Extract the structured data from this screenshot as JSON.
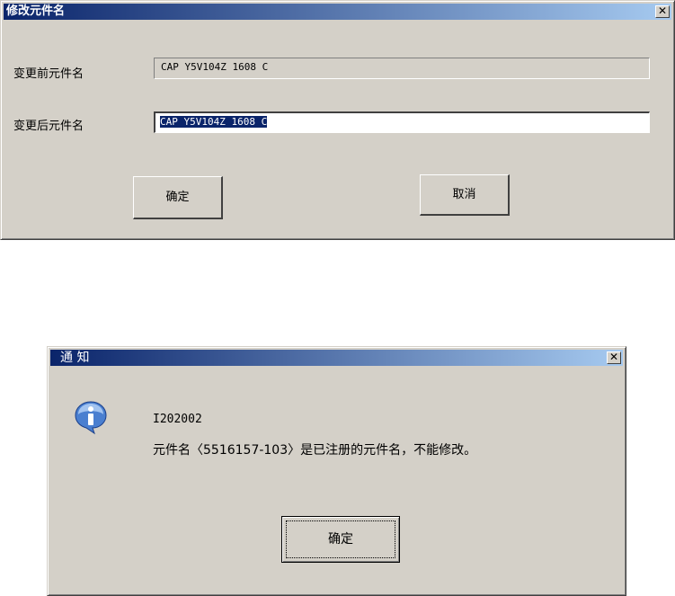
{
  "rename_dialog": {
    "title": "修改元件名",
    "close_symbol": "✕",
    "before_label": "变更前元件名",
    "before_value": "CAP Y5V104Z 1608 C",
    "after_label": "变更后元件名",
    "after_value": "CAP Y5V104Z 1608 C",
    "ok_label": "确定",
    "cancel_label": "取消"
  },
  "notice_dialog": {
    "title": "通 知",
    "close_symbol": "✕",
    "icon": "info-icon",
    "code": "I202002",
    "message": "元件名〈5516157-103〉是已注册的元件名，不能修改。",
    "ok_label": "确定"
  }
}
